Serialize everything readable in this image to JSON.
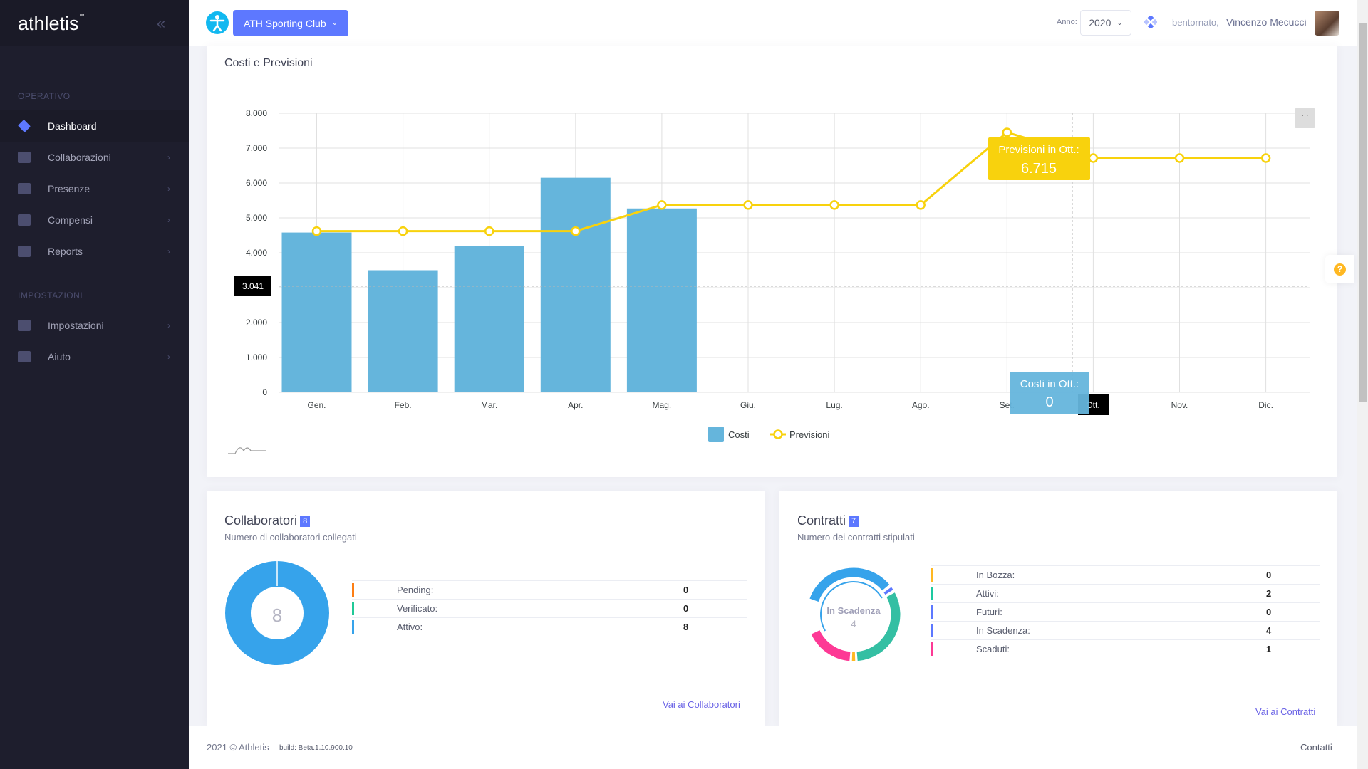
{
  "sidebar": {
    "logo": "athletis",
    "tm": "™",
    "sections": [
      {
        "label": "OPERATIVO"
      },
      {
        "label": "IMPOSTAZIONI"
      }
    ],
    "items": [
      {
        "label": "Dashboard",
        "icon": "layers-icon",
        "active": true
      },
      {
        "label": "Collaborazioni",
        "icon": "server-icon"
      },
      {
        "label": "Presenze",
        "icon": "arrows-in-icon"
      },
      {
        "label": "Compensi",
        "icon": "money-icon"
      },
      {
        "label": "Reports",
        "icon": "chart-line-icon"
      },
      {
        "label": "Impostazioni",
        "icon": "frame-icon"
      },
      {
        "label": "Aiuto",
        "icon": "grid-icon"
      }
    ]
  },
  "topbar": {
    "club": "ATH Sporting Club",
    "anno_label": "Anno:",
    "anno": "2020",
    "greeting": "bentornato,",
    "user": "Vincenzo Mecucci"
  },
  "chart_card": {
    "title": "Costi e Previsioni",
    "menu": "···",
    "help": "?"
  },
  "chart_data": {
    "type": "bar+line",
    "categories": [
      "Gen.",
      "Feb.",
      "Mar.",
      "Apr.",
      "Mag.",
      "Giu.",
      "Lug.",
      "Ago.",
      "Set.",
      "Ott.",
      "Nov.",
      "Dic."
    ],
    "ylim": [
      0,
      8000
    ],
    "yticks": [
      "0",
      "1.000",
      "2.000",
      "3.000",
      "4.000",
      "5.000",
      "6.000",
      "7.000",
      "8.000"
    ],
    "grid": true,
    "legend": "bottom",
    "series": [
      {
        "name": "Costi",
        "type": "bar",
        "color": "#65b5dc",
        "values": [
          4580,
          3500,
          4200,
          6150,
          5270,
          0,
          0,
          0,
          0,
          0,
          0,
          0
        ]
      },
      {
        "name": "Previsioni",
        "type": "line",
        "color": "#f8d20d",
        "values": [
          4620,
          4620,
          4620,
          4620,
          5370,
          5370,
          5370,
          5370,
          7450,
          6715,
          6715,
          6715
        ]
      }
    ],
    "crosshair": {
      "y_label": "3.041",
      "x_label": "Ott."
    },
    "tooltips": [
      {
        "title": "Previsioni in Ott.:",
        "value": "6.715"
      },
      {
        "title": "Costi in Ott.:",
        "value": "0"
      }
    ]
  },
  "collaboratori": {
    "title": "Collaboratori",
    "badge": "8",
    "subtitle": "Numero di collaboratori collegati",
    "center": "8",
    "rows": [
      {
        "label": "Pending:",
        "value": "0",
        "color": "#fd7e14"
      },
      {
        "label": "Verificato:",
        "value": "0",
        "color": "#20c997"
      },
      {
        "label": "Attivo:",
        "value": "8",
        "color": "#36a3eb"
      }
    ],
    "link": "Vai ai Collaboratori"
  },
  "contratti": {
    "title": "Contratti",
    "badge": "7",
    "subtitle": "Numero dei contratti stipulati",
    "center_label": "In Scadenza",
    "center_value": "4",
    "rows": [
      {
        "label": "In Bozza:",
        "value": "0",
        "color": "#ffb822"
      },
      {
        "label": "Attivi:",
        "value": "2",
        "color": "#1dc9a0"
      },
      {
        "label": "Futuri:",
        "value": "0",
        "color": "#5d78ff"
      },
      {
        "label": "In Scadenza:",
        "value": "4",
        "color": "#5d78ff"
      },
      {
        "label": "Scaduti:",
        "value": "1",
        "color": "#fd3995"
      }
    ],
    "link": "Vai ai Contratti"
  },
  "footer": {
    "copy": "2021 © Athletis",
    "build": "build: Beta.1.10.900.10",
    "contact": "Contatti"
  }
}
